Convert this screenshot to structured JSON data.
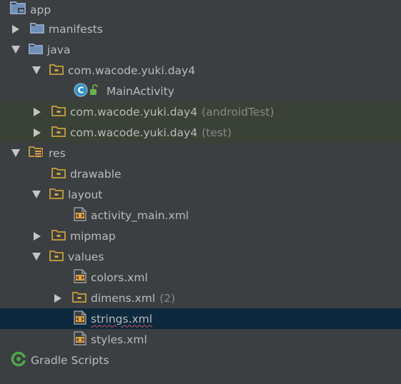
{
  "project_tree": {
    "root": {
      "label": "app",
      "icon": "module-folder-icon"
    },
    "manifests": {
      "label": "manifests",
      "icon": "folder-icon",
      "state": "collapsed"
    },
    "java": {
      "label": "java",
      "icon": "folder-icon",
      "state": "expanded"
    },
    "pkg_main": {
      "label": "com.wacode.yuki.day4",
      "icon": "package-folder-icon",
      "state": "expanded"
    },
    "main_activity": {
      "label": "MainActivity",
      "icon": "class-icon",
      "badge": "unlocked-icon"
    },
    "pkg_android_test": {
      "label": "com.wacode.yuki.day4",
      "suffix": "(androidTest)",
      "icon": "package-folder-icon",
      "state": "collapsed"
    },
    "pkg_test": {
      "label": "com.wacode.yuki.day4",
      "suffix": "(test)",
      "icon": "package-folder-icon",
      "state": "collapsed"
    },
    "res": {
      "label": "res",
      "icon": "resource-folder-icon",
      "state": "expanded"
    },
    "drawable": {
      "label": "drawable",
      "icon": "folder-icon"
    },
    "layout": {
      "label": "layout",
      "icon": "folder-icon",
      "state": "expanded"
    },
    "activity_main": {
      "label": "activity_main.xml",
      "icon": "xml-file-icon"
    },
    "mipmap": {
      "label": "mipmap",
      "icon": "folder-icon",
      "state": "collapsed"
    },
    "values": {
      "label": "values",
      "icon": "folder-icon",
      "state": "expanded"
    },
    "colors": {
      "label": "colors.xml",
      "icon": "xml-file-icon"
    },
    "dimens": {
      "label": "dimens.xml",
      "suffix": "(2)",
      "icon": "xml-file-icon",
      "state": "collapsed"
    },
    "strings": {
      "label": "strings.xml",
      "icon": "xml-file-icon",
      "selected": true
    },
    "styles": {
      "label": "styles.xml",
      "icon": "xml-file-icon"
    },
    "gradle": {
      "label": "Gradle Scripts",
      "icon": "gradle-icon"
    }
  },
  "colors": {
    "background": "#3c3f41",
    "selection": "#0d293e",
    "test_source_background": "#3a4137",
    "folder_blue": "#8aa4c8",
    "folder_yellow": "#b8953a",
    "xml_orange": "#e8a33c",
    "text": "#bbbbbb",
    "muted_text": "#888888"
  }
}
